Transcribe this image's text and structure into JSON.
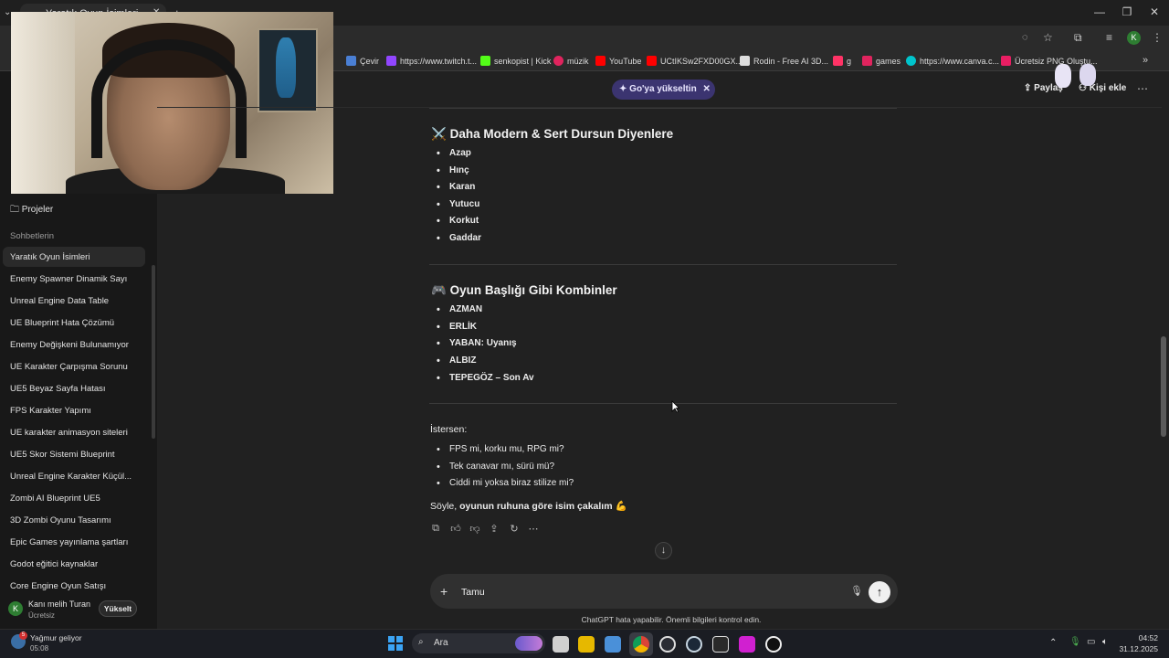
{
  "browser": {
    "tab_title": "Yaratık Oyun İsimleri",
    "profile_initial": "K",
    "bookmarks": [
      "Çevir",
      "https://www.twitch.t...",
      "senkopist | Kick",
      "müzik",
      "YouTube",
      "UCtIKSw2FXD00GX...",
      "Rodin - Free AI 3D...",
      "g",
      "games",
      "https://www.canva.c...",
      "Ücretsiz PNG Oluştu..."
    ],
    "bookmark_colors": [
      "#4a7fd4",
      "#9146ff",
      "#53fc18",
      "#e0245e",
      "#ff0000",
      "#ff0000",
      "#dddddd",
      "#ff3366",
      "#e0245e",
      "#00c4cc",
      "#e91e63"
    ]
  },
  "sidebar": {
    "projects_label": "Projeler",
    "section_label": "Sohbetlerin",
    "chats": [
      "Yaratık Oyun İsimleri",
      "Enemy Spawner Dinamik Sayı",
      "Unreal Engine Data Table",
      "UE Blueprint Hata Çözümü",
      "Enemy Değişkeni Bulunamıyor",
      "UE Karakter Çarpışma Sorunu",
      "UE5 Beyaz Sayfa Hatası",
      "FPS Karakter Yapımı",
      "UE karakter animasyon siteleri",
      "UE5 Skor Sistemi Blueprint",
      "Unreal Engine Karakter Küçül...",
      "Zombi AI Blueprint UE5",
      "3D Zombi Oyunu Tasarımı",
      "Epic Games yayınlama şartları",
      "Godot eğitici kaynaklar",
      "Core Engine Oyun Satışı"
    ],
    "user": {
      "initial": "K",
      "name": "Kanı melih Turan",
      "plan": "Ücretsiz",
      "upgrade_label": "Yükselt"
    }
  },
  "header": {
    "upgrade_pill": "Go'ya yükseltin",
    "share_label": "Paylaş",
    "add_person_label": "Kişi ekle"
  },
  "message": {
    "section1": {
      "icon": "⚔️",
      "title": "Daha Modern & Sert Dursun Diyenlere",
      "items": [
        "Azap",
        "Hınç",
        "Karan",
        "Yutucu",
        "Korkut",
        "Gaddar"
      ]
    },
    "section2": {
      "icon": "🎮",
      "title": "Oyun Başlığı Gibi Kombinler",
      "items": [
        "AZMAN",
        "ERLİK",
        "YABAN: Uyanış",
        "ALBIZ",
        "TEPEGÖZ – Son Av"
      ]
    },
    "intro": "İstersen:",
    "questions": [
      "FPS mi, korku mu, RPG mi?",
      "Tek canavar mı, sürü mü?",
      "Ciddi mi yoksa biraz stilize mi?"
    ],
    "closing_prefix": "Söyle, ",
    "closing_bold": "oyunun ruhuna göre isim çakalım",
    "closing_emoji": "💪"
  },
  "composer": {
    "value": "Tamu",
    "disclaimer": "ChatGPT hata yapabilir. Önemli bilgileri kontrol edin."
  },
  "taskbar": {
    "weather_title": "Yağmur geliyor",
    "weather_time": "05:08",
    "weather_badge": "5",
    "search_label": "Ara",
    "clock_time": "04:52",
    "clock_date": "31.12.2025"
  },
  "colors": {
    "accent_pill": "#3b3470",
    "background": "#212121",
    "sidebar": "#181818"
  }
}
